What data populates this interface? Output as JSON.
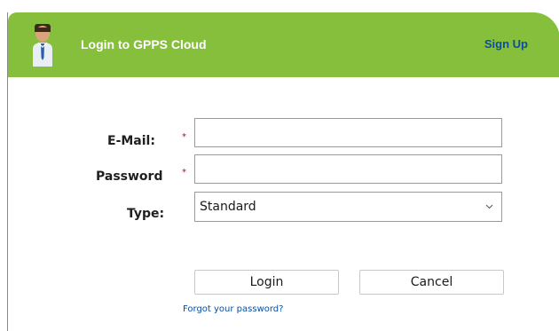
{
  "header": {
    "title": "Login to GPPS Cloud",
    "signup_label": "Sign Up",
    "avatar_icon": "user-avatar-icon",
    "background_color": "#86bf3b"
  },
  "form": {
    "email": {
      "label": "E-Mail:",
      "required_marker": "*",
      "value": "",
      "placeholder": ""
    },
    "password": {
      "label": "Password",
      "required_marker": "*",
      "value": "",
      "placeholder": ""
    },
    "type": {
      "label": "Type:",
      "selected": "Standard",
      "icon": "chevron-down-icon"
    }
  },
  "actions": {
    "login_label": "Login",
    "cancel_label": "Cancel",
    "forgot_label": "Forgot your password?"
  }
}
